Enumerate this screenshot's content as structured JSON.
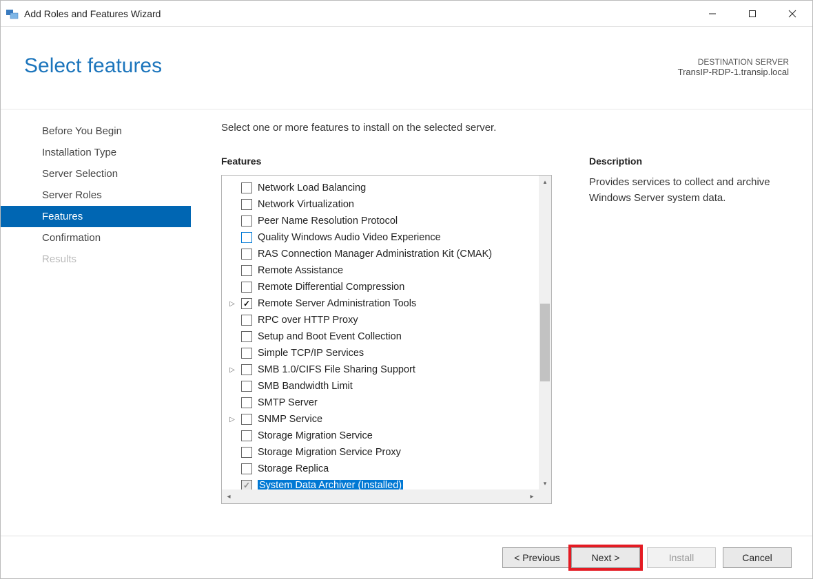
{
  "window": {
    "title": "Add Roles and Features Wizard"
  },
  "header": {
    "heading": "Select features",
    "destination_label": "DESTINATION SERVER",
    "destination_value": "TransIP-RDP-1.transip.local"
  },
  "sidebar": {
    "items": [
      {
        "label": "Before You Begin",
        "state": "normal"
      },
      {
        "label": "Installation Type",
        "state": "normal"
      },
      {
        "label": "Server Selection",
        "state": "normal"
      },
      {
        "label": "Server Roles",
        "state": "normal"
      },
      {
        "label": "Features",
        "state": "selected"
      },
      {
        "label": "Confirmation",
        "state": "normal"
      },
      {
        "label": "Results",
        "state": "disabled"
      }
    ]
  },
  "content": {
    "instruction": "Select one or more features to install on the selected server.",
    "features_label": "Features",
    "description_label": "Description",
    "description_text": "Provides services to collect and archive Windows Server system data.",
    "features": [
      {
        "label": "Network Load Balancing",
        "checked": false,
        "expandable": false
      },
      {
        "label": "Network Virtualization",
        "checked": false,
        "expandable": false
      },
      {
        "label": "Peer Name Resolution Protocol",
        "checked": false,
        "expandable": false
      },
      {
        "label": "Quality Windows Audio Video Experience",
        "checked": false,
        "expandable": false,
        "blue": true
      },
      {
        "label": "RAS Connection Manager Administration Kit (CMAK)",
        "checked": false,
        "expandable": false
      },
      {
        "label": "Remote Assistance",
        "checked": false,
        "expandable": false
      },
      {
        "label": "Remote Differential Compression",
        "checked": false,
        "expandable": false
      },
      {
        "label": "Remote Server Administration Tools",
        "checked": true,
        "expandable": true
      },
      {
        "label": "RPC over HTTP Proxy",
        "checked": false,
        "expandable": false
      },
      {
        "label": "Setup and Boot Event Collection",
        "checked": false,
        "expandable": false
      },
      {
        "label": "Simple TCP/IP Services",
        "checked": false,
        "expandable": false
      },
      {
        "label": "SMB 1.0/CIFS File Sharing Support",
        "checked": false,
        "expandable": true
      },
      {
        "label": "SMB Bandwidth Limit",
        "checked": false,
        "expandable": false
      },
      {
        "label": "SMTP Server",
        "checked": false,
        "expandable": false
      },
      {
        "label": "SNMP Service",
        "checked": false,
        "expandable": true
      },
      {
        "label": "Storage Migration Service",
        "checked": false,
        "expandable": false
      },
      {
        "label": "Storage Migration Service Proxy",
        "checked": false,
        "expandable": false
      },
      {
        "label": "Storage Replica",
        "checked": false,
        "expandable": false
      },
      {
        "label": "System Data Archiver (Installed)",
        "checked": "grey",
        "expandable": false,
        "selected": true
      }
    ]
  },
  "footer": {
    "previous": "< Previous",
    "next": "Next >",
    "install": "Install",
    "cancel": "Cancel"
  }
}
